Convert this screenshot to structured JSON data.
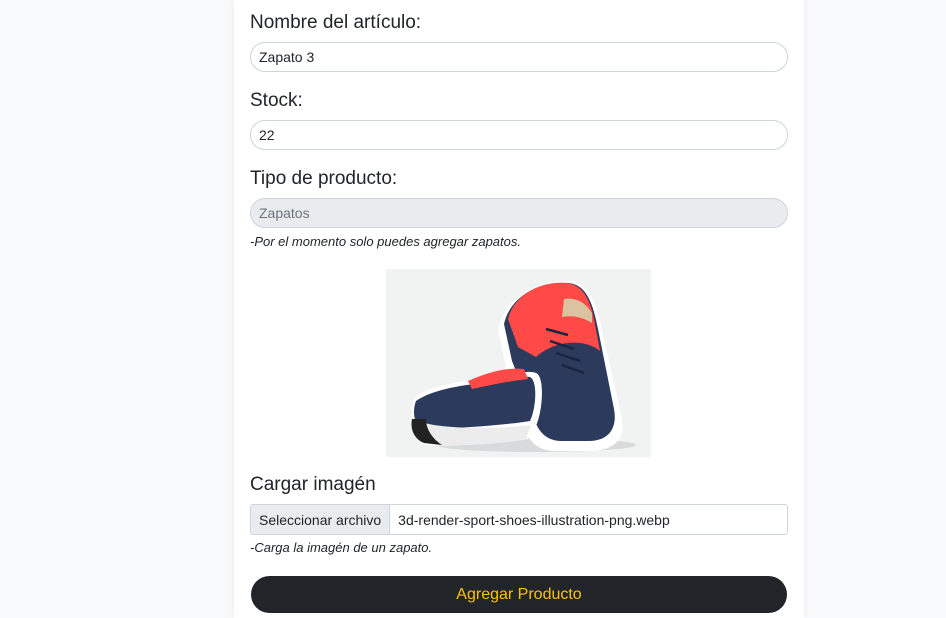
{
  "form": {
    "name_label": "Nombre del artículo:",
    "name_value": "Zapato 3",
    "stock_label": "Stock:",
    "stock_value": "22",
    "type_label": "Tipo de producto:",
    "type_value": "Zapatos",
    "type_hint": "-Por el momento solo puedes agregar zapatos.",
    "image_label": "Cargar imagén",
    "file_button_label": "Seleccionar archivo",
    "file_name": "3d-render-sport-shoes-illustration-png.webp",
    "image_hint": "-Carga la imagén de un zapato.",
    "submit_label": "Agregar Producto"
  },
  "preview": {
    "icon": "sneaker-image"
  },
  "colors": {
    "page_bg": "#f8f9fa",
    "button_bg": "#212529",
    "button_text": "#ffc107",
    "disabled_bg": "#e9ecef"
  }
}
